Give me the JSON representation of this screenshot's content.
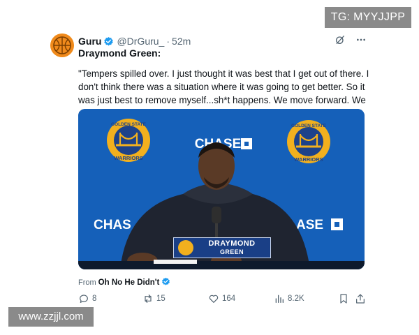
{
  "overlay": {
    "tg_badge": "TG: MYYJJPP",
    "site_watermark": "www.zzjjl.com"
  },
  "tweet": {
    "author_name": "Guru",
    "author_handle": "@DrGuru_",
    "separator": "·",
    "timestamp": "52m",
    "subject": "Draymond Green:",
    "quote": "\"Tempers spilled over. I just thought it was best that I get out of there. I don't think there was a situation where it was going to get better. So it was just best to remove myself...sh*t happens. We move forward. We alright\"",
    "source_prefix": "From",
    "source_name": "Oh No He Didn't"
  },
  "media": {
    "backdrop_sponsor": "CHASE",
    "team_logo_top": "GOLDEN STATE",
    "team_logo_bottom": "WARRIORS",
    "left_partial": "CHAS",
    "right_partial": "ASE",
    "nameplate_first": "DRAYMOND",
    "nameplate_last": "GREEN"
  },
  "metrics": {
    "replies": "8",
    "reposts": "15",
    "likes": "164",
    "views": "8.2K"
  },
  "icons": {
    "verified": "verified-badge-icon",
    "grok": "grok-icon",
    "more": "more-icon",
    "reply": "reply-icon",
    "repost": "repost-icon",
    "like": "like-icon",
    "views": "views-icon",
    "bookmark": "bookmark-icon",
    "share": "share-icon"
  },
  "colors": {
    "verified_blue": "#1d9bf0",
    "media_blue": "#1560b9",
    "warriors_gold": "#f2b01e",
    "muted_text": "#536471"
  }
}
